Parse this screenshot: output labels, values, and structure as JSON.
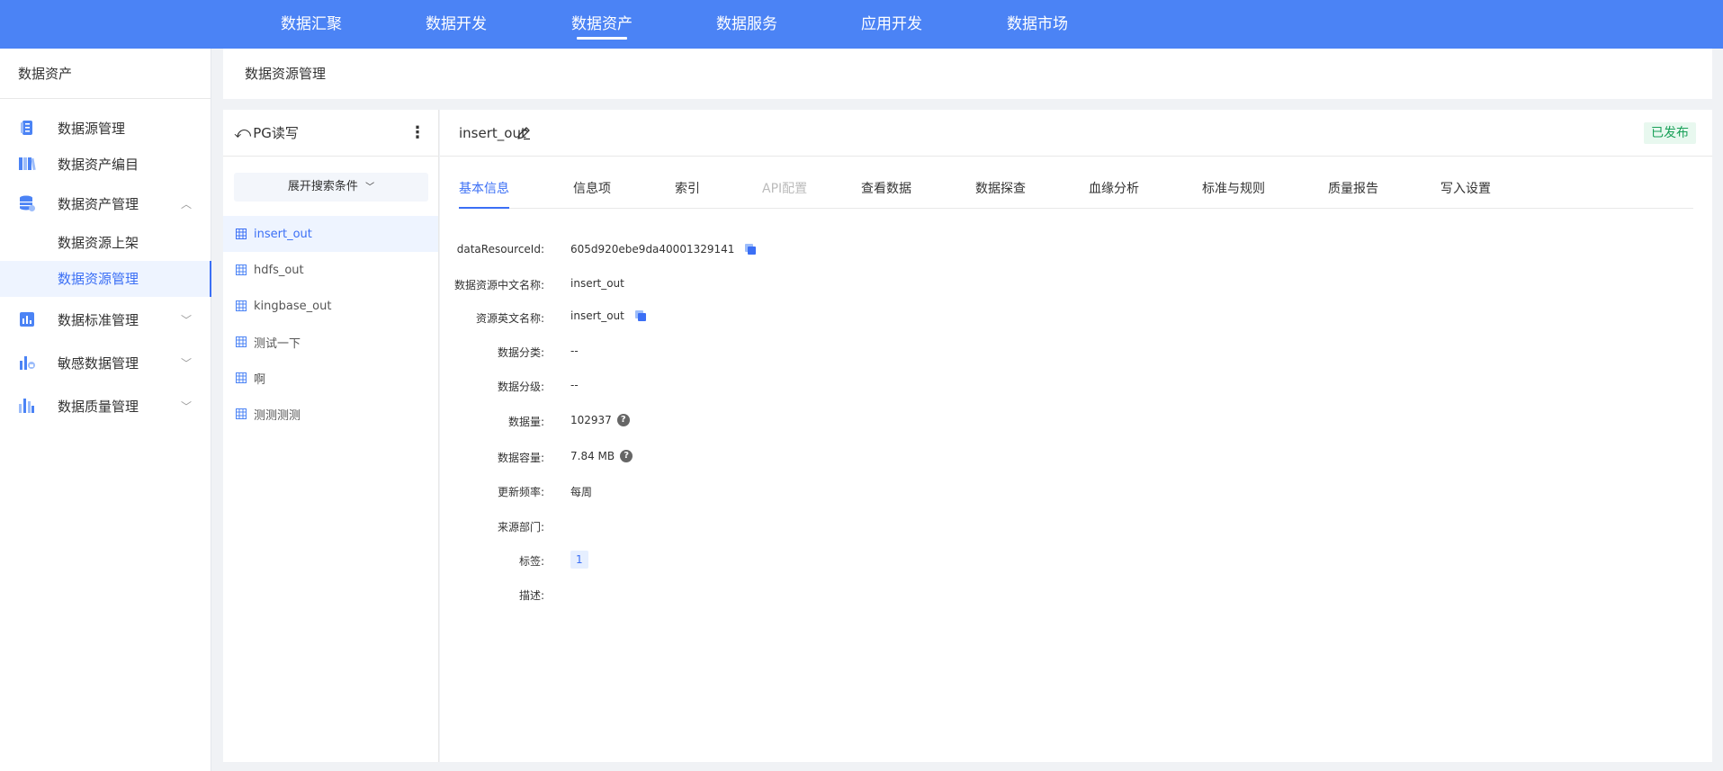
{
  "topnav": {
    "items": [
      "数据汇聚",
      "数据开发",
      "数据资产",
      "数据服务",
      "应用开发",
      "数据市场"
    ],
    "active_index": 2
  },
  "sidebar": {
    "title": "数据资产",
    "items": [
      {
        "label": "数据源管理",
        "icon": "database-icon"
      },
      {
        "label": "数据资产编目",
        "icon": "catalog-icon"
      },
      {
        "label": "数据资产管理",
        "icon": "db-manage-icon",
        "expanded": true,
        "children": [
          {
            "label": "数据资源上架"
          },
          {
            "label": "数据资源管理",
            "active": true
          }
        ]
      },
      {
        "label": "数据标准管理",
        "icon": "standard-chart-icon"
      },
      {
        "label": "敏感数据管理",
        "icon": "sensitive-data-icon"
      },
      {
        "label": "数据质量管理",
        "icon": "quality-icon"
      }
    ]
  },
  "breadcrumb": "数据资源管理",
  "list_panel": {
    "title": "PG读写",
    "filter_label": "展开搜索条件",
    "items": [
      "insert_out",
      "hdfs_out",
      "kingbase_out",
      "测试一下",
      "啊",
      "测测测测"
    ],
    "active_index": 0
  },
  "detail": {
    "title": "insert_out",
    "status": "已发布",
    "tabs": [
      "基本信息",
      "信息项",
      "索引",
      "API配置",
      "查看数据",
      "数据探查",
      "血缘分析",
      "标准与规则",
      "质量报告",
      "写入设置"
    ],
    "active_tab": 0,
    "disabled_tab": 3,
    "fields": [
      {
        "label": "dataResourceId:",
        "value": "605d920ebe9da40001329141",
        "copy": true
      },
      {
        "label": "数据资源中文名称:",
        "value": "insert_out"
      },
      {
        "label": "资源英文名称:",
        "value": "insert_out",
        "copy": true
      },
      {
        "label": "数据分类:",
        "value": "--"
      },
      {
        "label": "数据分级:",
        "value": "--"
      },
      {
        "label": "数据量:",
        "value": "102937",
        "help": true
      },
      {
        "label": "数据容量:",
        "value": "7.84 MB",
        "help": true
      },
      {
        "label": "更新频率:",
        "value": "每周"
      },
      {
        "label": "来源部门:",
        "value": ""
      },
      {
        "label": "标签:",
        "tag": "1"
      },
      {
        "label": "描述:",
        "value": ""
      }
    ]
  },
  "colors": {
    "primary": "#4b83f5",
    "accent": "#3b6ff5",
    "success": "#18a058"
  }
}
